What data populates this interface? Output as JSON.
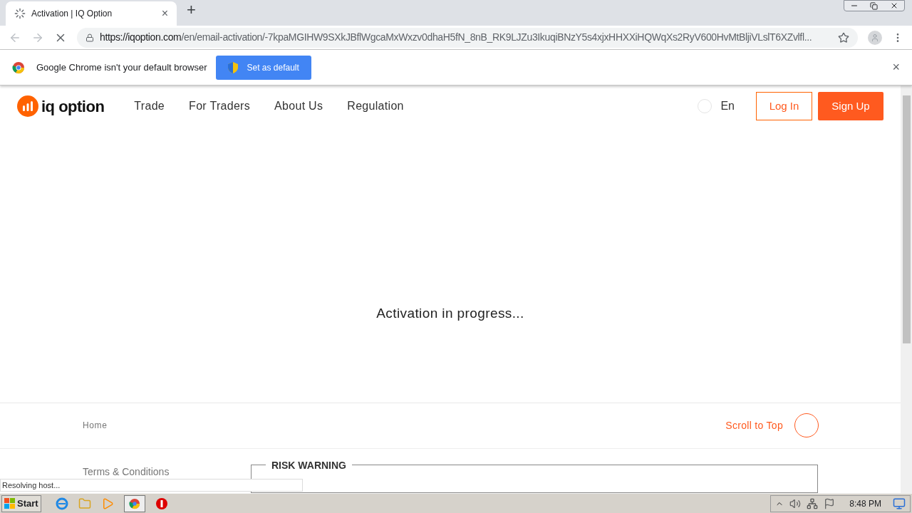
{
  "browser": {
    "tab_title": "Activation | IQ Option",
    "tab_close": "×",
    "new_tab": "+",
    "url_host": "https://iqoption.com",
    "url_path": "/en/email-activation/-7kpaMGIHW9SXkJBflWgcaMxWxzv0dhaH5fN_8nB_RK9LJZu3IkuqiBNzY5s4xjxHHXXiHQWqXs2RyV600HvMtBljiVLslT6XZvlfl..."
  },
  "infobar": {
    "message": "Google Chrome isn't your default browser",
    "button": "Set as default",
    "close": "×"
  },
  "site": {
    "logo": "iq option",
    "nav": [
      "Trade",
      "For Traders",
      "About Us",
      "Regulation"
    ],
    "language": "En",
    "login": "Log In",
    "signup": "Sign Up"
  },
  "main": {
    "message": "Activation in progress..."
  },
  "footer": {
    "home": "Home",
    "scroll_top": "Scroll to Top",
    "terms": "Terms & Conditions",
    "risk_title": "RISK WARNING"
  },
  "status_bubble": "Resolving host...",
  "taskbar": {
    "start": "Start",
    "time": "8:48 PM"
  }
}
